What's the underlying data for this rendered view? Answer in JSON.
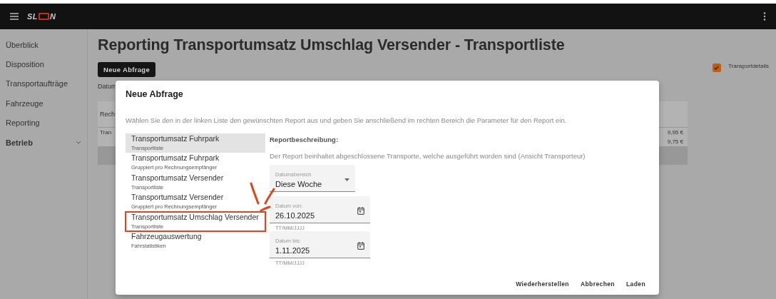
{
  "topbar": {
    "logo": [
      "SL",
      "N"
    ]
  },
  "sidebar": {
    "items": [
      {
        "label": "Überblick",
        "kind": "link"
      },
      {
        "label": "Disposition",
        "kind": "link"
      },
      {
        "label": "Transportaufträge",
        "kind": "link"
      },
      {
        "label": "Fahrzeuge",
        "kind": "link"
      },
      {
        "label": "Reporting",
        "kind": "link"
      },
      {
        "label": "Betrieb",
        "kind": "group",
        "expanded": false
      }
    ]
  },
  "page": {
    "title": "Reporting Transportumsatz Umschlag Versender - Transportliste",
    "new_query_button": "Neue Abfrage",
    "date_label": "Datum",
    "transport_details": {
      "label": "Transportdetails",
      "checked": true
    },
    "table": {
      "column_1": "Rech",
      "rows": [
        {
          "column_1": "Tran",
          "amount": "9,95 €"
        },
        {
          "amount": "9,75 €"
        }
      ]
    }
  },
  "dialog": {
    "title": "Neue Abfrage",
    "instructions": "Wählen Sie den in der linken Liste den gewünschten Report aus und geben Sie anschließend im rechten Bereich die Parameter für den Report ein.",
    "reports": [
      {
        "title": "Transportumsatz Fuhrpark",
        "subtitle": "Transportliste",
        "selected": true,
        "highlighted": false
      },
      {
        "title": "Transportumsatz Fuhrpark",
        "subtitle": "Gruppiert pro Rechnungsempfänger",
        "selected": false,
        "highlighted": false
      },
      {
        "title": "Transportumsatz Versender",
        "subtitle": "Transportliste",
        "selected": false,
        "highlighted": false
      },
      {
        "title": "Transportumsatz Versender",
        "subtitle": "Gruppiert pro Rechnungsempfänger",
        "selected": false,
        "highlighted": false
      },
      {
        "title": "Transportumsatz Umschlag Versender",
        "subtitle": "Transportliste",
        "selected": false,
        "highlighted": true
      },
      {
        "title": "Fahrzeugauswertung",
        "subtitle": "Fahrstatistiken",
        "selected": false,
        "highlighted": false
      }
    ],
    "description_heading": "Reportbeschreibung:",
    "description": "Der Report beinhaltet abgeschlossene Transporte, welche ausgeführt worden sind (Ansicht Transporteur)",
    "fields": [
      {
        "kind": "select",
        "label": "Datumsbereich",
        "value": "Diese Woche"
      },
      {
        "kind": "date",
        "label": "Datum von:",
        "value": "26.10.2025",
        "helper": "TT/MM/JJJJ"
      },
      {
        "kind": "date",
        "label": "Datum bis:",
        "value": "1.11.2025",
        "helper": "TT/MM/JJJJ"
      }
    ],
    "buttons": [
      "Wiederherstellen",
      "Abbrechen",
      "Laden"
    ]
  }
}
